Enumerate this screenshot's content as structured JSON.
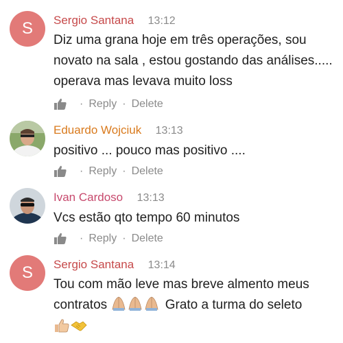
{
  "colors": {
    "author_red": "#c6494a",
    "author_orange": "#d97a1d",
    "author_pink": "#c7496d",
    "avatar_bg": "#e27a78",
    "meta_gray": "#8a8a8a"
  },
  "comments": [
    {
      "author": "Sergio Santana",
      "time": "13:12",
      "avatar_letter": "S",
      "text": "Diz uma grana hoje em três operações, sou novato na sala , estou gostando das análises..... operava mas levava muito loss",
      "reply_label": "Reply",
      "delete_label": "Delete",
      "separator": "·"
    },
    {
      "author": "Eduardo Wojciuk",
      "time": "13:13",
      "text": "positivo ... pouco mas positivo ....",
      "reply_label": "Reply",
      "delete_label": "Delete",
      "separator": "·"
    },
    {
      "author": "Ivan Cardoso",
      "time": "13:13",
      "text": "Vcs estão qto tempo 60 minutos",
      "reply_label": "Reply",
      "delete_label": "Delete",
      "separator": "·"
    },
    {
      "author": "Sergio Santana",
      "time": "13:14",
      "avatar_letter": "S",
      "text_part1": "Tou com mão leve mas breve almento meus contratos ",
      "text_part2": " Grato a turma do seleto"
    }
  ],
  "icons": {
    "like": "thumbs-up-icon",
    "praying_hands": "praying-hands-emoji",
    "thumbs_up": "thumbs-up-emoji",
    "handshake": "handshake-emoji"
  }
}
